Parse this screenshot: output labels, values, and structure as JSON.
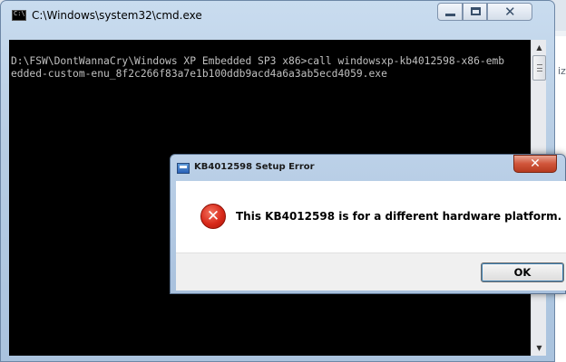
{
  "background_app": {
    "partial_text": "ize"
  },
  "cmd_window": {
    "title": "C:\\Windows\\system32\\cmd.exe",
    "icon_text": "C:\\",
    "lines": [
      "D:\\FSW\\DontWannaCry\\Windows XP Embedded SP3 x86>call windowsxp-kb4012598-x86-emb",
      "edded-custom-enu_8f2c266f83a7e1b100ddb9acd4a6a3ab5ecd4059.exe"
    ],
    "console_bg": "#000000",
    "console_fg": "#c0c0c0"
  },
  "dialog": {
    "title": "KB4012598 Setup Error",
    "message": "This KB4012598 is for a different hardware platform.",
    "ok_label": "OK",
    "close_glyph": "✕",
    "error_glyph": "✕",
    "accent_close": "#d0553a",
    "error_color": "#d8291a"
  },
  "scrollbar": {
    "up_glyph": "▲",
    "down_glyph": "▼"
  }
}
